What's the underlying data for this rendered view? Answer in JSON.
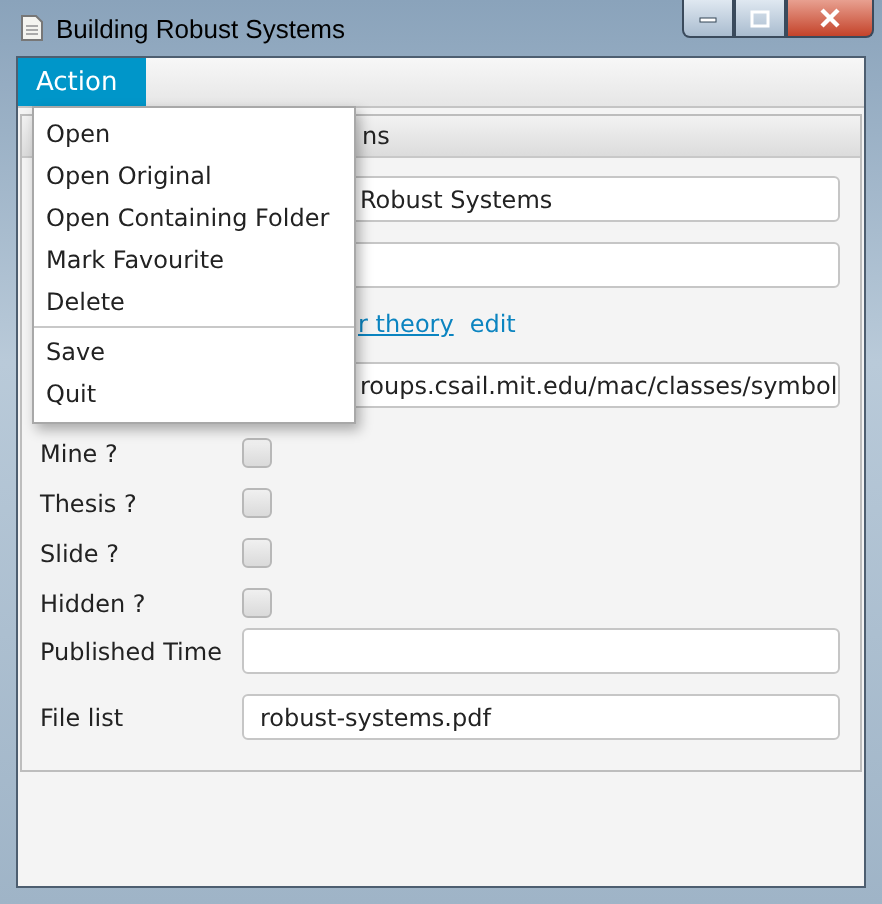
{
  "window": {
    "title": "Building Robust Systems"
  },
  "menu_bar": [
    {
      "label": "Action",
      "selected": true
    }
  ],
  "menu": {
    "sections": [
      {
        "items": [
          "Open",
          "Open Original",
          "Open Containing Folder",
          "Mark Favourite",
          "Delete"
        ]
      },
      {
        "items": [
          "Save",
          "Quit"
        ]
      }
    ]
  },
  "pane": {
    "title": "ns"
  },
  "form": [
    {
      "kind": "field",
      "value": "Robust Systems"
    },
    {
      "kind": "field"
    },
    {
      "kind": "links",
      "links": [
        {
          "text": "r theory",
          "underlined": true
        },
        {
          "text": "edit",
          "underlined": false
        }
      ]
    },
    {
      "kind": "field",
      "value": "roups.csail.mit.edu/mac/classes/symbol"
    },
    {
      "kind": "checkbox",
      "label": "Mine ?",
      "checked": false
    },
    {
      "kind": "checkbox",
      "label": "Thesis ?",
      "checked": false
    },
    {
      "kind": "checkbox",
      "label": "Slide ?",
      "checked": false
    },
    {
      "kind": "checkbox",
      "label": "Hidden ?",
      "checked": false
    },
    {
      "kind": "field",
      "label": "Published Time"
    },
    {
      "kind": "field",
      "label": "File list",
      "value": "robust-systems.pdf"
    }
  ]
}
